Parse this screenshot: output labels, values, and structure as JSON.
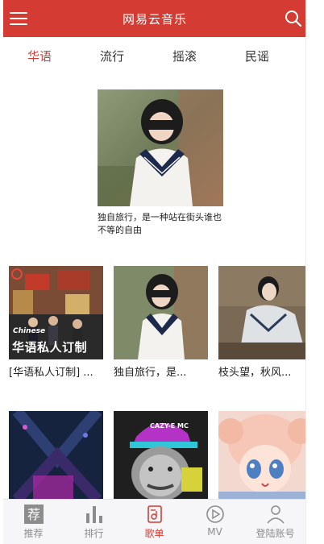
{
  "header": {
    "title": "网易云音乐"
  },
  "tabs": [
    {
      "label": "华语",
      "active": true
    },
    {
      "label": "流行",
      "active": false
    },
    {
      "label": "摇滚",
      "active": false
    },
    {
      "label": "民谣",
      "active": false
    }
  ],
  "feature": {
    "caption": "独自旅行，是一种站在街头谁也不等的自由"
  },
  "row1": [
    {
      "label": "[华语私人订制] ...",
      "cover_text_small": "Chinese",
      "cover_text_big": "华语私人订制"
    },
    {
      "label": "独自旅行，是..."
    },
    {
      "label": "枝头望，秋风..."
    }
  ],
  "row2": [
    {
      "cover_text": ""
    },
    {
      "cover_text": "CAZY-E MC"
    },
    {
      "cover_text": ""
    }
  ],
  "bottom_nav": [
    {
      "label": "推荐",
      "icon": "recommend-icon",
      "active": false
    },
    {
      "label": "排行",
      "icon": "chart-bars-icon",
      "active": false
    },
    {
      "label": "歌单",
      "icon": "playlist-icon",
      "active": true
    },
    {
      "label": "MV",
      "icon": "play-circle-icon",
      "active": false
    },
    {
      "label": "登陆账号",
      "icon": "user-icon",
      "active": false
    }
  ],
  "colors": {
    "brand": "#d43c33",
    "nav_bg": "#f6f6f8",
    "inactive": "#8c8c8c"
  }
}
